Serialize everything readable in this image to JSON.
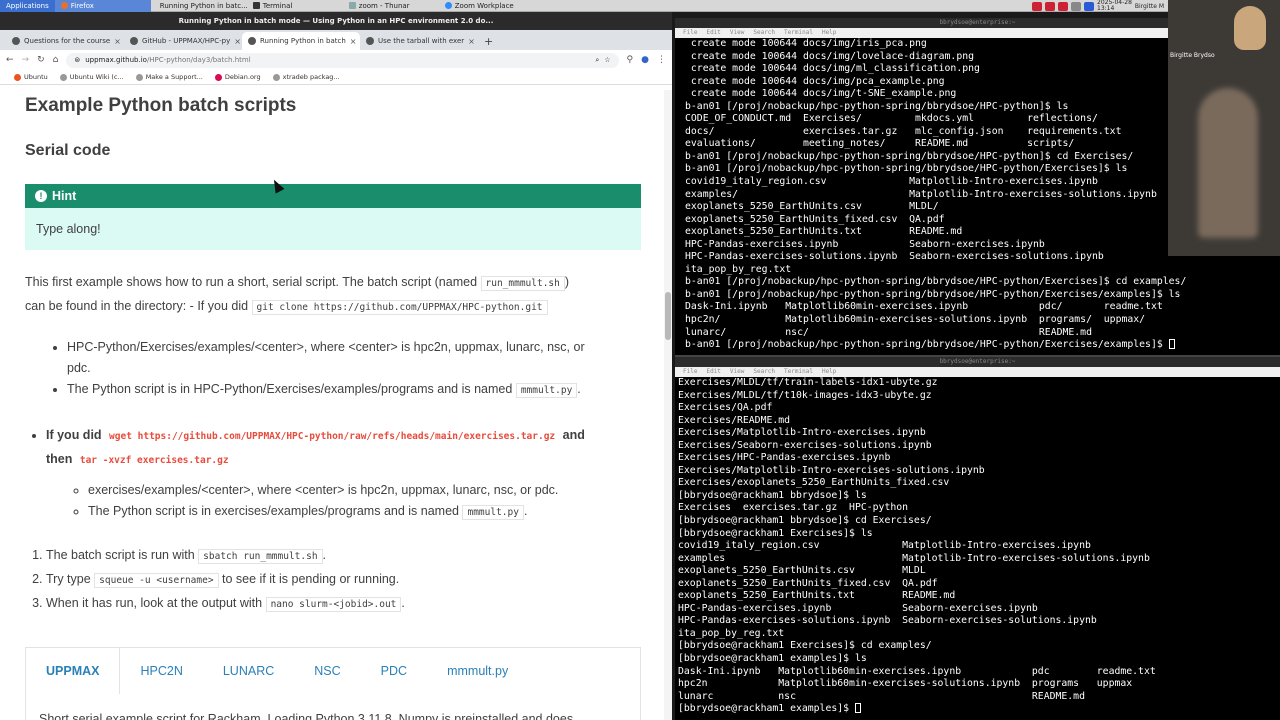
{
  "taskbar": {
    "items": [
      {
        "label": "Applications"
      },
      {
        "label": "Firefox"
      },
      {
        "label": "Running Python in batc..."
      },
      {
        "label": "Terminal"
      },
      {
        "label": "zoom - Thunar"
      },
      {
        "label": "Zoom Workplace"
      }
    ],
    "clock": "2025-04-28\n13:14",
    "user": "Birgitte M"
  },
  "browser": {
    "window_title": "Running Python in batch mode — Using Python in an HPC environment 2.0 do...",
    "tabs": [
      {
        "label": "Questions for the course"
      },
      {
        "label": "GitHub - UPPMAX/HPC-py"
      },
      {
        "label": "Running Python in batch"
      },
      {
        "label": "Use the tarball with exer"
      }
    ],
    "url_host": "uppmax.github.io",
    "url_path": "/HPC-python/day3/batch.html",
    "bookmarks": [
      "Ubuntu",
      "Ubuntu Wiki (c...",
      "Make a Support...",
      "Debian.org",
      "xtradeb packag..."
    ]
  },
  "page": {
    "title": "Example Python batch scripts",
    "section": "Serial code",
    "hint_title": "Hint",
    "hint_body": "Type along!",
    "intro_1": "This first example shows how to run a short, serial script. The batch script (named ",
    "intro_code": "run_mmmult.sh",
    "intro_2": ")",
    "intro_3": "can be found in the directory: - If you did ",
    "intro_code2": "git clone https://github.com/UPPMAX/HPC-python.git",
    "b1_1": "HPC-Python/Exercises/examples/<center>, where <center> is hpc2n, uppmax, lunarc, nsc, or",
    "b1_2": "pdc.",
    "b2": "The Python script is in HPC-Python/Exercises/examples/programs and is named ",
    "b2_code": "mmmult.py",
    "b2_end": ".",
    "wget_pre": "If you did ",
    "wget_code": "wget https://github.com/UPPMAX/HPC-python/raw/refs/heads/main/exercises.tar.gz",
    "wget_and": " and",
    "wget_then": "then ",
    "wget_code2": "tar -xvzf exercises.tar.gz",
    "c1": "exercises/examples/<center>, where <center> is hpc2n, uppmax, lunarc, nsc, or pdc.",
    "c2": "The Python script is in exercises/examples/programs and is named ",
    "c2_code": "mmmult.py",
    "c2_end": ".",
    "step1": "The batch script is run with ",
    "step1_code": "sbatch run_mmmult.sh",
    "step1_end": ".",
    "step2": "Try type ",
    "step2_code": "squeue -u <username>",
    "step2_end": " to see if it is pending or running.",
    "step3": "When it has run, look at the output with ",
    "step3_code": "nano slurm-<jobid>.out",
    "step3_end": ".",
    "center_tabs": [
      "UPPMAX",
      "HPC2N",
      "LUNARC",
      "NSC",
      "PDC",
      "mmmult.py"
    ],
    "tab_text": "Short serial example script for Rackham. Loading Python 3.11.8. Numpy is preinstalled and does"
  },
  "term1": {
    "title": "bbrydsoe@enterprise:~",
    "menu": [
      "File",
      "Edit",
      "View",
      "Search",
      "Terminal",
      "Help"
    ],
    "lines": [
      " create mode 100644 docs/img/iris_pca.png",
      " create mode 100644 docs/img/lovelace-diagram.png",
      " create mode 100644 docs/img/ml_classification.png",
      " create mode 100644 docs/img/pca_example.png",
      " create mode 100644 docs/img/t-SNE_example.png",
      "b-an01 [/proj/nobackup/hpc-python-spring/bbrydsoe/HPC-python]$ ls",
      "CODE_OF_CONDUCT.md  Exercises/         mkdocs.yml         reflections/",
      "docs/               exercises.tar.gz   mlc_config.json    requirements.txt",
      "evaluations/        meeting_notes/     README.md          scripts/",
      "b-an01 [/proj/nobackup/hpc-python-spring/bbrydsoe/HPC-python]$ cd Exercises/",
      "b-an01 [/proj/nobackup/hpc-python-spring/bbrydsoe/HPC-python/Exercises]$ ls",
      "covid19_italy_region.csv              Matplotlib-Intro-exercises.ipynb",
      "examples/                             Matplotlib-Intro-exercises-solutions.ipynb",
      "exoplanets_5250_EarthUnits.csv        MLDL/",
      "exoplanets_5250_EarthUnits_fixed.csv  QA.pdf",
      "exoplanets_5250_EarthUnits.txt        README.md",
      "HPC-Pandas-exercises.ipynb            Seaborn-exercises.ipynb",
      "HPC-Pandas-exercises-solutions.ipynb  Seaborn-exercises-solutions.ipynb",
      "ita_pop_by_reg.txt",
      "b-an01 [/proj/nobackup/hpc-python-spring/bbrydsoe/HPC-python/Exercises]$ cd examples/",
      "b-an01 [/proj/nobackup/hpc-python-spring/bbrydsoe/HPC-python/Exercises/examples]$ ls",
      "Dask-Ini.ipynb   Matplotlib60min-exercises.ipynb            pdc/       readme.txt",
      "hpc2n/           Matplotlib60min-exercises-solutions.ipynb  programs/  uppmax/",
      "lunarc/          nsc/                                       README.md",
      "b-an01 [/proj/nobackup/hpc-python-spring/bbrydsoe/HPC-python/Exercises/examples]$ "
    ]
  },
  "term2": {
    "title": "bbrydsoe@enterprise:~",
    "menu": [
      "File",
      "Edit",
      "View",
      "Search",
      "Terminal",
      "Help"
    ],
    "lines": [
      "Exercises/MLDL/tf/train-labels-idx1-ubyte.gz",
      "Exercises/MLDL/tf/t10k-images-idx3-ubyte.gz",
      "Exercises/QA.pdf",
      "Exercises/README.md",
      "Exercises/Matplotlib-Intro-exercises.ipynb",
      "Exercises/Seaborn-exercises-solutions.ipynb",
      "Exercises/HPC-Pandas-exercises.ipynb",
      "Exercises/Matplotlib-Intro-exercises-solutions.ipynb",
      "Exercises/exoplanets_5250_EarthUnits_fixed.csv",
      "[bbrydsoe@rackham1 bbrydsoe]$ ls",
      "Exercises  exercises.tar.gz  HPC-python",
      "[bbrydsoe@rackham1 bbrydsoe]$ cd Exercises/",
      "[bbrydsoe@rackham1 Exercises]$ ls",
      "covid19_italy_region.csv              Matplotlib-Intro-exercises.ipynb",
      "examples                              Matplotlib-Intro-exercises-solutions.ipynb",
      "exoplanets_5250_EarthUnits.csv        MLDL",
      "exoplanets_5250_EarthUnits_fixed.csv  QA.pdf",
      "exoplanets_5250_EarthUnits.txt        README.md",
      "HPC-Pandas-exercises.ipynb            Seaborn-exercises.ipynb",
      "HPC-Pandas-exercises-solutions.ipynb  Seaborn-exercises-solutions.ipynb",
      "ita_pop_by_reg.txt",
      "[bbrydsoe@rackham1 Exercises]$ cd examples/",
      "[bbrydsoe@rackham1 examples]$ ls",
      "Dask-Ini.ipynb   Matplotlib60min-exercises.ipynb            pdc        readme.txt",
      "hpc2n            Matplotlib60min-exercises-solutions.ipynb  programs   uppmax",
      "lunarc           nsc                                        README.md",
      "[bbrydsoe@rackham1 examples]$ "
    ]
  },
  "video": {
    "participant": "Birgitte Brydso"
  }
}
